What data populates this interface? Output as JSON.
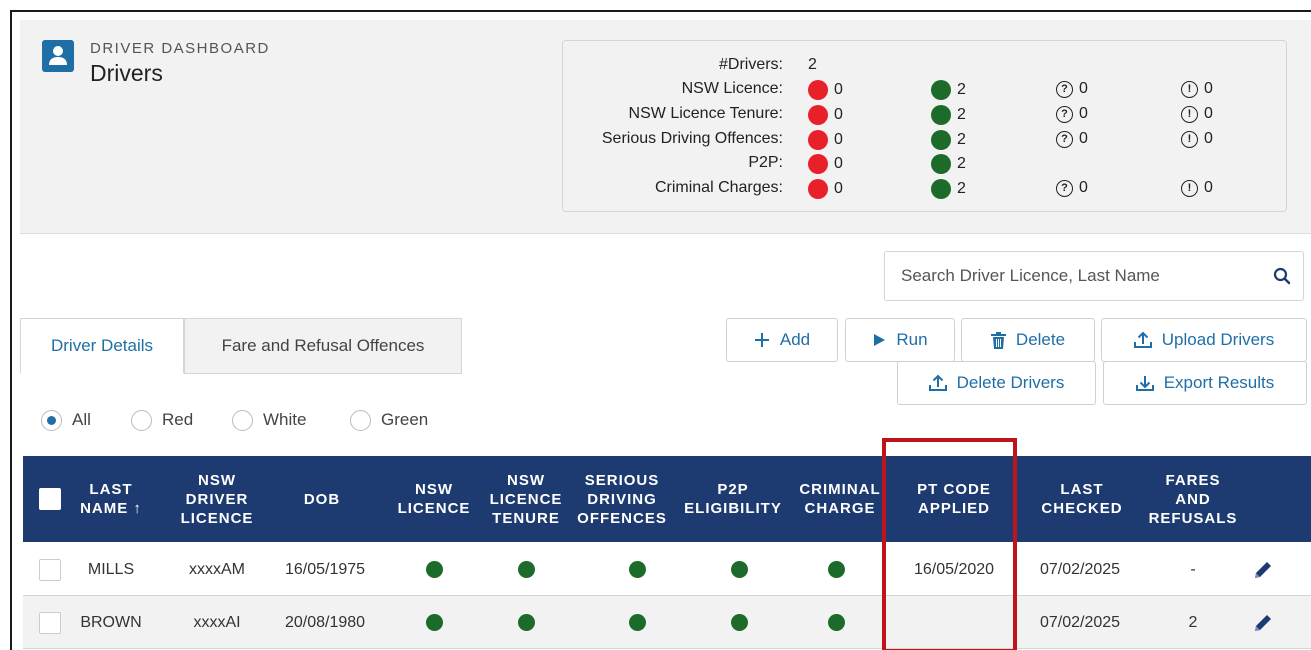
{
  "header": {
    "label": "DRIVER DASHBOARD",
    "title": "Drivers",
    "icon": "user-icon"
  },
  "summary": {
    "drivers_label": "#Drivers:",
    "drivers_count": "2",
    "rows": [
      {
        "label": "NSW Licence:",
        "red": "0",
        "green": "2",
        "unknown": "0",
        "info": "0"
      },
      {
        "label": "NSW Licence Tenure:",
        "red": "0",
        "green": "2",
        "unknown": "0",
        "info": "0"
      },
      {
        "label": "Serious Driving Offences:",
        "red": "0",
        "green": "2",
        "unknown": "0",
        "info": "0"
      },
      {
        "label": "P2P:",
        "red": "0",
        "green": "2"
      },
      {
        "label": "Criminal Charges:",
        "red": "0",
        "green": "2",
        "unknown": "0",
        "info": "0"
      }
    ],
    "colors": {
      "red": "#e8202a",
      "green": "#1d6b2b"
    }
  },
  "search": {
    "placeholder": "Search Driver Licence, Last Name"
  },
  "tabs": [
    {
      "label": "Driver Details",
      "active": true
    },
    {
      "label": "Fare and Refusal Offences",
      "active": false
    }
  ],
  "toolbar": {
    "add": "Add",
    "run": "Run",
    "delete": "Delete",
    "upload": "Upload Drivers",
    "delete_drivers": "Delete Drivers",
    "export": "Export Results"
  },
  "filters": [
    {
      "label": "All",
      "selected": true
    },
    {
      "label": "Red",
      "selected": false
    },
    {
      "label": "White",
      "selected": false
    },
    {
      "label": "Green",
      "selected": false
    }
  ],
  "table": {
    "columns": [
      "LAST\nNAME ↑",
      "NSW\nDRIVER\nLICENCE",
      "DOB",
      "NSW\nLICENCE",
      "NSW\nLICENCE\nTENURE",
      "SERIOUS\nDRIVING\nOFFENCES",
      "P2P\nELIGIBILITY",
      "CRIMINAL\nCHARGE",
      "PT CODE\nAPPLIED",
      "LAST\nCHECKED",
      "FARES\nAND\nREFUSALS"
    ],
    "rows": [
      {
        "last_name": "MILLS",
        "licence": "xxxxAM",
        "dob": "16/05/1975",
        "pt_code_applied": "16/05/2020",
        "last_checked": "07/02/2025",
        "fares_refusals": "-"
      },
      {
        "last_name": "BROWN",
        "licence": "xxxxAI",
        "dob": "20/08/1980",
        "pt_code_applied": "",
        "last_checked": "07/02/2025",
        "fares_refusals": "2"
      }
    ],
    "header_color": "#1d3b70",
    "status_color": "#1d6b2b"
  }
}
